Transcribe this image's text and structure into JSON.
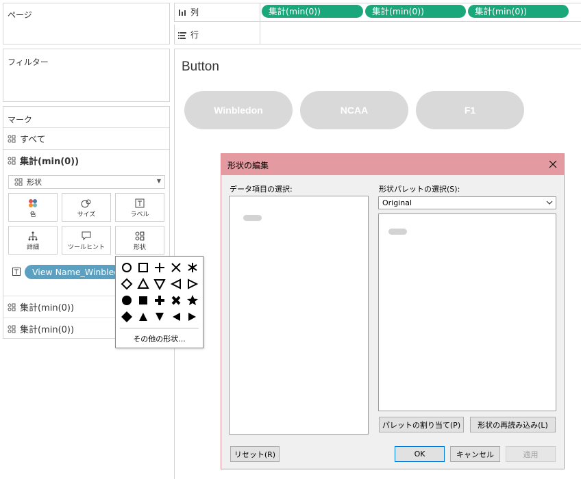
{
  "shelves": {
    "pages_label": "ページ",
    "filters_label": "フィルター",
    "columns_label": "列",
    "rows_label": "行",
    "column_pills": [
      "集計(min(0))",
      "集計(min(0))",
      "集計(min(0))"
    ]
  },
  "marks": {
    "title": "マーク",
    "all_label": "すべて",
    "active_label": "集計(min(0))",
    "type_dropdown": "形状",
    "buttons": {
      "color": "色",
      "size": "サイズ",
      "label": "ラベル",
      "detail": "詳細",
      "tooltip": "ツールヒント",
      "shape": "形状"
    },
    "field_pill": "View Name_Winbledon",
    "other_rows": [
      "集計(min(0))",
      "集計(min(0))"
    ]
  },
  "view": {
    "title": "Button",
    "buttons": [
      "Winbledon",
      "NCAA",
      "F1"
    ]
  },
  "shape_popup": {
    "more_shapes": "その他の形状..."
  },
  "dialog": {
    "title": "形状の編集",
    "data_item_label": "データ項目の選択:",
    "palette_label": "形状パレットの選択(S):",
    "palette_value": "Original",
    "assign_button": "パレットの割り当て(P)",
    "reload_button": "形状の再読み込み(L)",
    "reset_button": "リセット(R)",
    "ok_button": "OK",
    "cancel_button": "キャンセル",
    "apply_button": "適用"
  },
  "colors": {
    "pill_green": "#1aa77a",
    "pill_blue": "#5b9fc1",
    "dialog_header": "#e39aa1",
    "view_button": "#d9d9d9"
  }
}
